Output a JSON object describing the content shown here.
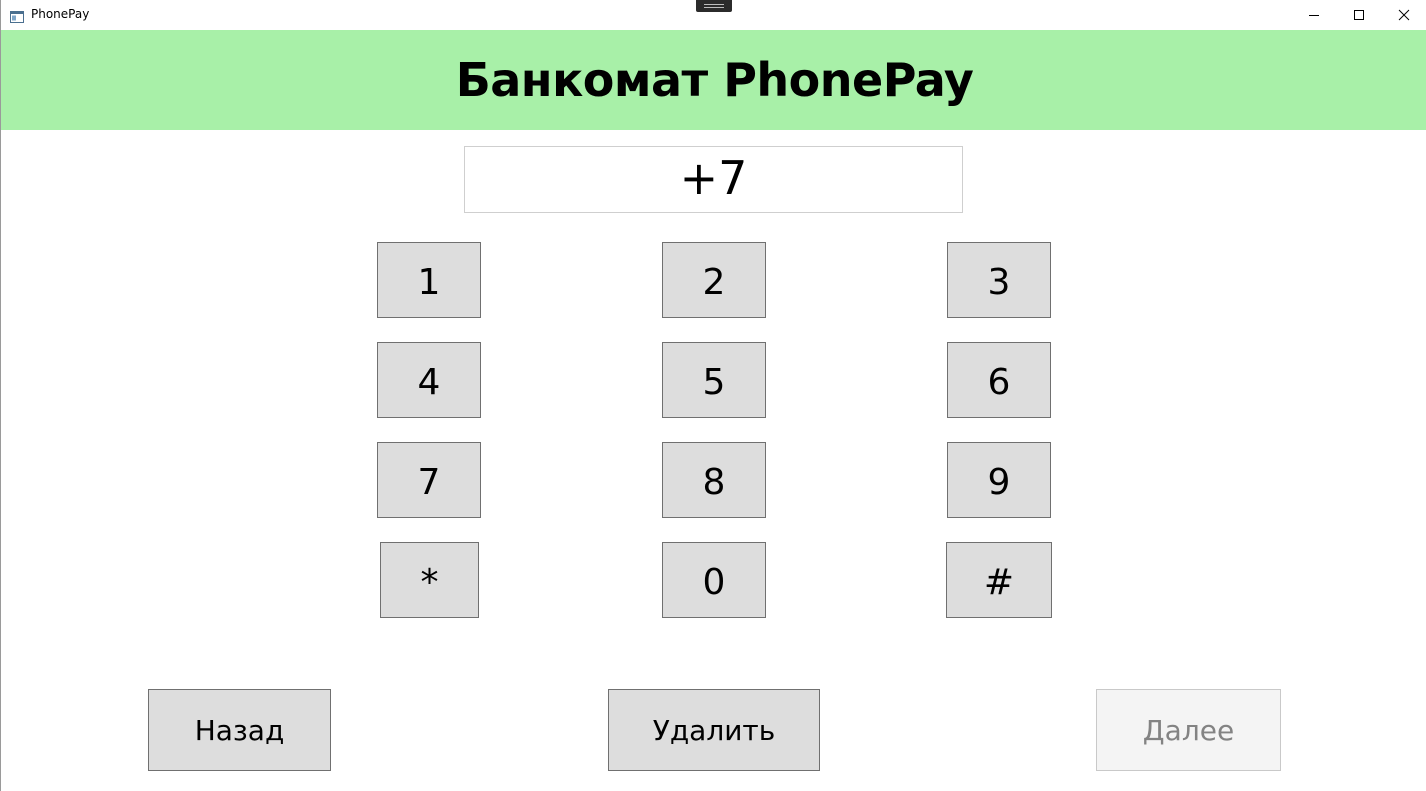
{
  "window": {
    "title": "PhonePay"
  },
  "header": {
    "title": "Банкомат PhonePay",
    "background": "#a8f0a8"
  },
  "phone_input": {
    "value": "+7"
  },
  "keypad": {
    "keys": [
      "1",
      "2",
      "3",
      "4",
      "5",
      "6",
      "7",
      "8",
      "9",
      "*",
      "0",
      "#"
    ]
  },
  "actions": {
    "back_label": "Назад",
    "delete_label": "Удалить",
    "next_label": "Далее",
    "next_enabled": false
  },
  "icons": {
    "app": "app-window-icon",
    "minimize": "minimize-icon",
    "maximize": "maximize-icon",
    "close": "close-icon"
  }
}
